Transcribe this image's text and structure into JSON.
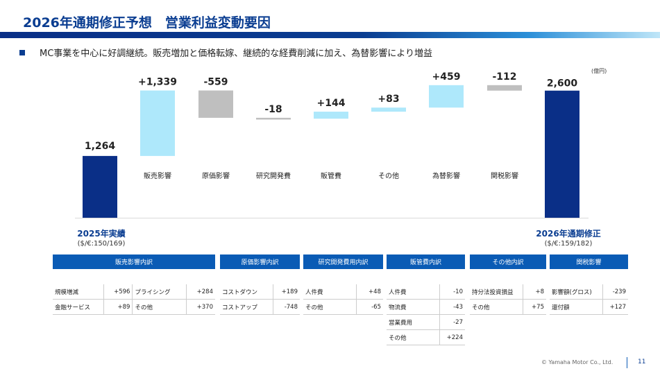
{
  "header": {
    "title": "2026年通期修正予想　営業利益変動要因",
    "bullet": "MC事業を中心に好調継続。販売増加と価格転嫁、継続的な経費削減に加え、為替影響により増益"
  },
  "colors": {
    "title": "#0a3d91",
    "total_bar": "#0a2f87",
    "positive_bar": "#aee8fb",
    "negative_bar": "#bfbfbf",
    "table_header": "#0a5bb5"
  },
  "chart_data": {
    "type": "bar",
    "subtype": "waterfall",
    "unit": "(億円)",
    "start": {
      "label": "2025年実績",
      "rate": "($/€:150/169)",
      "value": 1264,
      "value_label": "1,264"
    },
    "end": {
      "label": "2026年通期修正",
      "rate": "($/€:159/182)",
      "value": 2600,
      "value_label": "2,600"
    },
    "steps": [
      {
        "category": "販売影響",
        "value": 1339,
        "value_label": "+1,339"
      },
      {
        "category": "原価影響",
        "value": -559,
        "value_label": "-559"
      },
      {
        "category": "研究開発費",
        "value": -18,
        "value_label": "-18"
      },
      {
        "category": "販管費",
        "value": 144,
        "value_label": "+144"
      },
      {
        "category": "その他",
        "value": 83,
        "value_label": "+83"
      },
      {
        "category": "為替影響",
        "value": 459,
        "value_label": "+459"
      },
      {
        "category": "関税影響",
        "value": -112,
        "value_label": "-112"
      }
    ],
    "legend": "none",
    "grid": false
  },
  "breakdowns": [
    {
      "title": "販売影響内訳",
      "rows": [
        {
          "label": "規模増減",
          "value": "+596",
          "label2": "プライシング",
          "value2": "+284"
        },
        {
          "label": "金融サービス",
          "value": "+89",
          "label2": "その他",
          "value2": "+370"
        }
      ]
    },
    {
      "title": "原価影響内訳",
      "rows": [
        {
          "label": "コストダウン",
          "value": "+189"
        },
        {
          "label": "コストアップ",
          "value": "-748"
        }
      ]
    },
    {
      "title": "研究開発費用内訳",
      "rows": [
        {
          "label": "人件費",
          "value": "+48"
        },
        {
          "label": "その他",
          "value": "-65"
        }
      ]
    },
    {
      "title": "販管費内訳",
      "rows": [
        {
          "label": "人件費",
          "value": "-10"
        },
        {
          "label": "物流費",
          "value": "-43"
        },
        {
          "label": "営業費用",
          "value": "-27"
        },
        {
          "label": "その他",
          "value": "+224"
        }
      ]
    },
    {
      "title": "その他内訳",
      "rows": [
        {
          "label": "持分法投資損益",
          "value": "+8"
        },
        {
          "label": "その他",
          "value": "+75"
        }
      ]
    },
    {
      "title": "関税影響",
      "rows": [
        {
          "label": "影響額(グロス)",
          "value": "-239"
        },
        {
          "label": "還付額",
          "value": "+127"
        }
      ]
    }
  ],
  "footer": {
    "copyright": "© Yamaha Motor Co., Ltd.",
    "page_number": "11"
  }
}
